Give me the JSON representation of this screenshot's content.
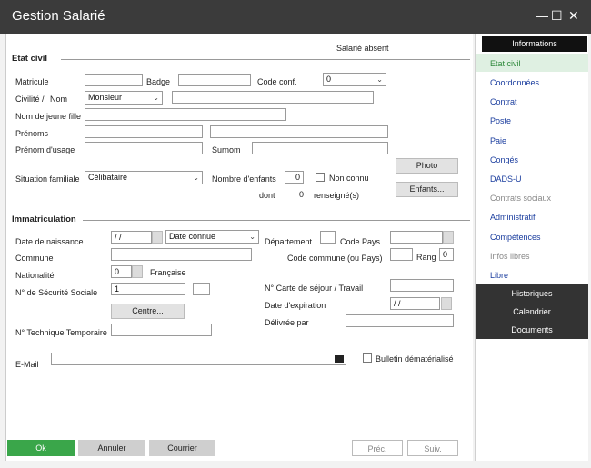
{
  "window": {
    "title": "Gestion Salarié",
    "min": "—",
    "max": "☐",
    "close": "✕"
  },
  "header": {
    "status": "Salarié absent"
  },
  "etat_civil": {
    "section": "Etat civil",
    "matricule": "Matricule",
    "badge": "Badge",
    "code_conf": "Code conf.",
    "code_conf_value": "0",
    "civilite": "Civilité /",
    "nom": "Nom",
    "civilite_value": "Monsieur",
    "nom_jeune_fille": "Nom de jeune fille",
    "prenoms": "Prénoms",
    "prenom_usage": "Prénom d'usage",
    "surnom": "Surnom",
    "situation": "Situation familiale",
    "situation_value": "Célibataire",
    "nb_enfants": "Nombre d'enfants",
    "nb_enfants_value": "0",
    "non_connu": "Non connu",
    "dont": "dont",
    "dont_value": "0",
    "renseignes": "renseigné(s)",
    "photo_btn": "Photo",
    "enfants_btn": "Enfants..."
  },
  "immatriculation": {
    "section": "Immatriculation",
    "date_naissance": "Date de naissance",
    "date_naissance_value": "/ /",
    "date_connue": "Date connue",
    "departement": "Département",
    "code_pays": "Code Pays",
    "commune": "Commune",
    "code_commune": "Code commune (ou Pays)",
    "rang": "Rang",
    "rang_value": "0",
    "nationalite": "Nationalité",
    "nationalite_value": "0",
    "francaise": "Française",
    "secu": "N° de Sécurité Sociale",
    "secu_value": "1",
    "carte_sejour": "N° Carte de séjour / Travail",
    "date_expiration": "Date d'expiration",
    "date_expiration_value": "/ /",
    "centre_btn": "Centre...",
    "delivree": "Délivrée par",
    "technique": "N° Technique Temporaire",
    "email": "E-Mail",
    "bulletin": "Bulletin dématérialisé"
  },
  "sidebar": {
    "header": "Informations",
    "items": [
      {
        "label": "Etat civil"
      },
      {
        "label": "Coordonnées"
      },
      {
        "label": "Contrat"
      },
      {
        "label": "Poste"
      },
      {
        "label": "Paie"
      },
      {
        "label": "Congés"
      },
      {
        "label": "DADS-U"
      },
      {
        "label": "Contrats sociaux"
      },
      {
        "label": "Administratif"
      },
      {
        "label": "Compétences"
      },
      {
        "label": "Infos libres"
      },
      {
        "label": "Libre"
      }
    ],
    "footer": [
      "Historiques",
      "Calendrier",
      "Documents"
    ]
  },
  "buttons": {
    "ok": "Ok",
    "annuler": "Annuler",
    "courrier": "Courrier",
    "prec": "Préc.",
    "suiv": "Suiv."
  },
  "colors": {
    "titlebar": "#3b3b3b",
    "ok": "#3aa64a",
    "sidebar_active": "#dff0e2",
    "link": "#1a3d9e"
  }
}
